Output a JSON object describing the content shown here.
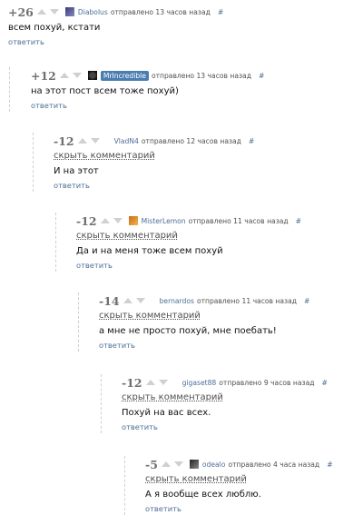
{
  "reply_label": "ответить",
  "hide_label": "скрыть комментарий",
  "hash": "#",
  "comments": [
    {
      "score": "+26",
      "author": "Diabolus",
      "time": "отправлено 13 часов назад",
      "text": "всем похуй, кстати"
    },
    {
      "score": "+12",
      "author": "MrIncredible",
      "time": "отправлено 13 часов назад",
      "text": "на этот пост всем тоже похуй)"
    },
    {
      "score": "-12",
      "author": "VladN4",
      "time": "отправлено 12 часов назад",
      "text": "И на этот"
    },
    {
      "score": "-12",
      "author": "MisterLemon",
      "time": "отправлено 11 часов назад",
      "text": "Да и на меня тоже всем похуй"
    },
    {
      "score": "-14",
      "author": "bernardos",
      "time": "отправлено 11 часов назад",
      "text": "а мне не просто похуй, мне поебать!"
    },
    {
      "score": "-12",
      "author": "gigaset88",
      "time": "отправлено 9 часов назад",
      "text": "Похуй на вас всех."
    },
    {
      "score": "-5",
      "author": "odealo",
      "time": "отправлено 4 часа назад",
      "text": "А я вообще всех люблю."
    }
  ]
}
